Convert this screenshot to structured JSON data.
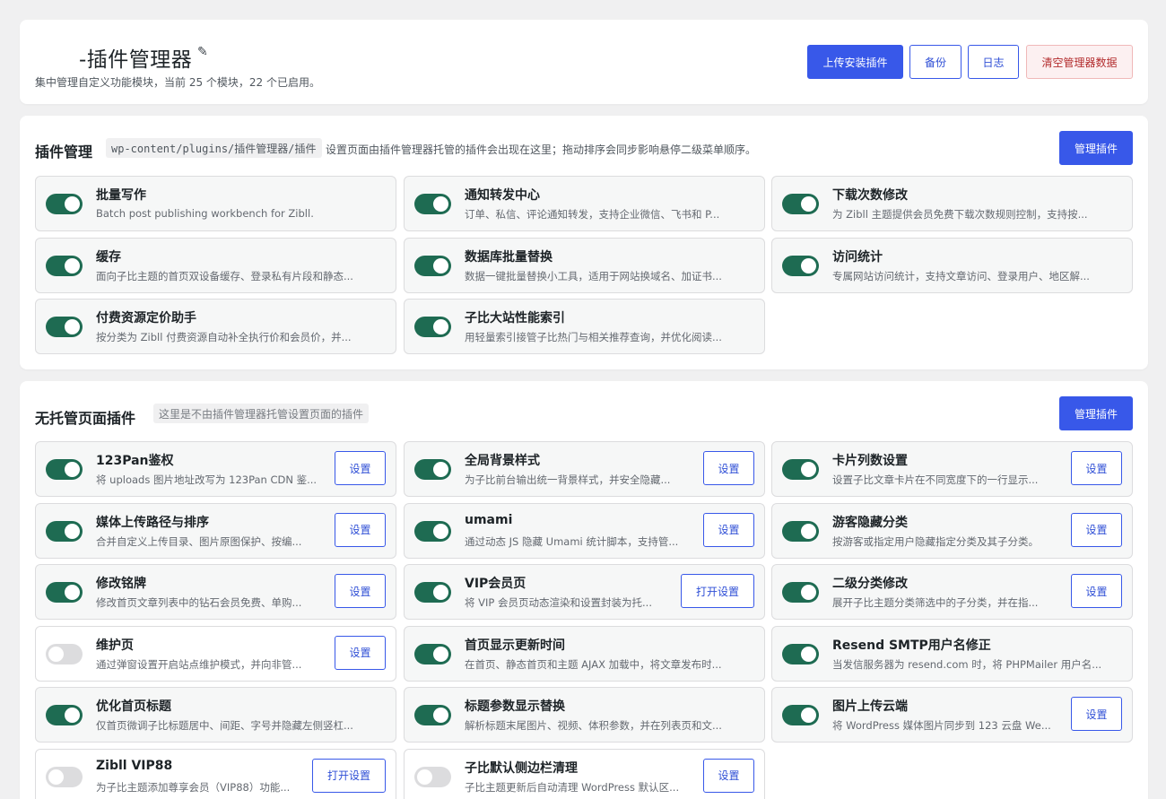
{
  "header": {
    "title": "-插件管理器",
    "description": "集中管理自定义功能模块，当前 25 个模块，22 个已启用。",
    "buttons": {
      "upload": "上传安装插件",
      "backup": "备份",
      "log": "日志",
      "clear": "清空管理器数据"
    }
  },
  "managed_section": {
    "title": "插件管理",
    "path_tag": "wp-content/plugins/插件管理器/插件",
    "description": "设置页面由插件管理器托管的插件会出现在这里；拖动排序会同步影响悬停二级菜单顺序。",
    "manage_button": "管理插件",
    "plugins": [
      {
        "name": "批量写作",
        "desc": "Batch post publishing workbench for Zibll.",
        "enabled": true
      },
      {
        "name": "通知转发中心",
        "desc": "订单、私信、评论通知转发，支持企业微信、飞书和 P...",
        "enabled": true
      },
      {
        "name": "下载次数修改",
        "desc": "为 Zibll 主题提供会员免费下载次数规则控制，支持按...",
        "enabled": true
      },
      {
        "name": "缓存",
        "desc": "面向子比主题的首页双设备缓存、登录私有片段和静态...",
        "enabled": true
      },
      {
        "name": "数据库批量替换",
        "desc": "数据一键批量替换小工具，适用于网站换域名、加证书...",
        "enabled": true
      },
      {
        "name": "访问统计",
        "desc": "专属网站访问统计，支持文章访问、登录用户、地区解...",
        "enabled": true
      },
      {
        "name": "付费资源定价助手",
        "desc": "按分类为 Zibll 付费资源自动补全执行价和会员价，并...",
        "enabled": true
      },
      {
        "name": "子比大站性能索引",
        "desc": "用轻量索引接管子比热门与相关推荐查询，并优化阅读...",
        "enabled": true
      }
    ]
  },
  "unmanaged_section": {
    "title": "无托管页面插件",
    "tag": "这里是不由插件管理器托管设置页面的插件",
    "manage_button": "管理插件",
    "plugins": [
      {
        "name": "123Pan鉴权",
        "desc": "将 uploads 图片地址改写为 123Pan CDN 鉴...",
        "enabled": true,
        "button": "设置"
      },
      {
        "name": "全局背景样式",
        "desc": "为子比前台输出统一背景样式，并安全隐藏...",
        "enabled": true,
        "button": "设置"
      },
      {
        "name": "卡片列数设置",
        "desc": "设置子比文章卡片在不同宽度下的一行显示...",
        "enabled": true,
        "button": "设置"
      },
      {
        "name": "媒体上传路径与排序",
        "desc": "合并自定义上传目录、图片原图保护、按编...",
        "enabled": true,
        "button": "设置"
      },
      {
        "name": "umami",
        "desc": "通过动态 JS 隐藏 Umami 统计脚本，支持管...",
        "enabled": true,
        "button": "设置"
      },
      {
        "name": "游客隐藏分类",
        "desc": "按游客或指定用户隐藏指定分类及其子分类。",
        "enabled": true,
        "button": "设置"
      },
      {
        "name": "修改铭牌",
        "desc": "修改首页文章列表中的钻石会员免费、单购...",
        "enabled": true,
        "button": "设置"
      },
      {
        "name": "VIP会员页",
        "desc": "将 VIP 会员页动态渲染和设置封装为托...",
        "enabled": true,
        "button": "打开设置"
      },
      {
        "name": "二级分类修改",
        "desc": "展开子比主题分类筛选中的子分类，并在指...",
        "enabled": true,
        "button": "设置"
      },
      {
        "name": "维护页",
        "desc": "通过弹窗设置开启站点维护模式，并向非管...",
        "enabled": false,
        "button": "设置"
      },
      {
        "name": "首页显示更新时间",
        "desc": "在首页、静态首页和主题 AJAX 加载中，将文章发布时...",
        "enabled": true,
        "button": ""
      },
      {
        "name": "Resend SMTP用户名修正",
        "desc": "当发信服务器为 resend.com 时，将 PHPMailer 用户名...",
        "enabled": true,
        "button": ""
      },
      {
        "name": "优化首页标题",
        "desc": "仅首页微调子比标题居中、间距、字号并隐藏左侧竖杠...",
        "enabled": true,
        "button": ""
      },
      {
        "name": "标题参数显示替换",
        "desc": "解析标题末尾图片、视频、体积参数，并在列表页和文...",
        "enabled": true,
        "button": ""
      },
      {
        "name": "图片上传云端",
        "desc": "将 WordPress 媒体图片同步到 123 云盘 We...",
        "enabled": true,
        "button": "设置"
      },
      {
        "name": "Zibll VIP88",
        "desc": "为子比主题添加尊享会员（VIP88）功能...",
        "enabled": false,
        "button": "打开设置"
      },
      {
        "name": "子比默认侧边栏清理",
        "desc": "子比主题更新后自动清理 WordPress 默认区...",
        "enabled": false,
        "button": "设置"
      }
    ]
  }
}
